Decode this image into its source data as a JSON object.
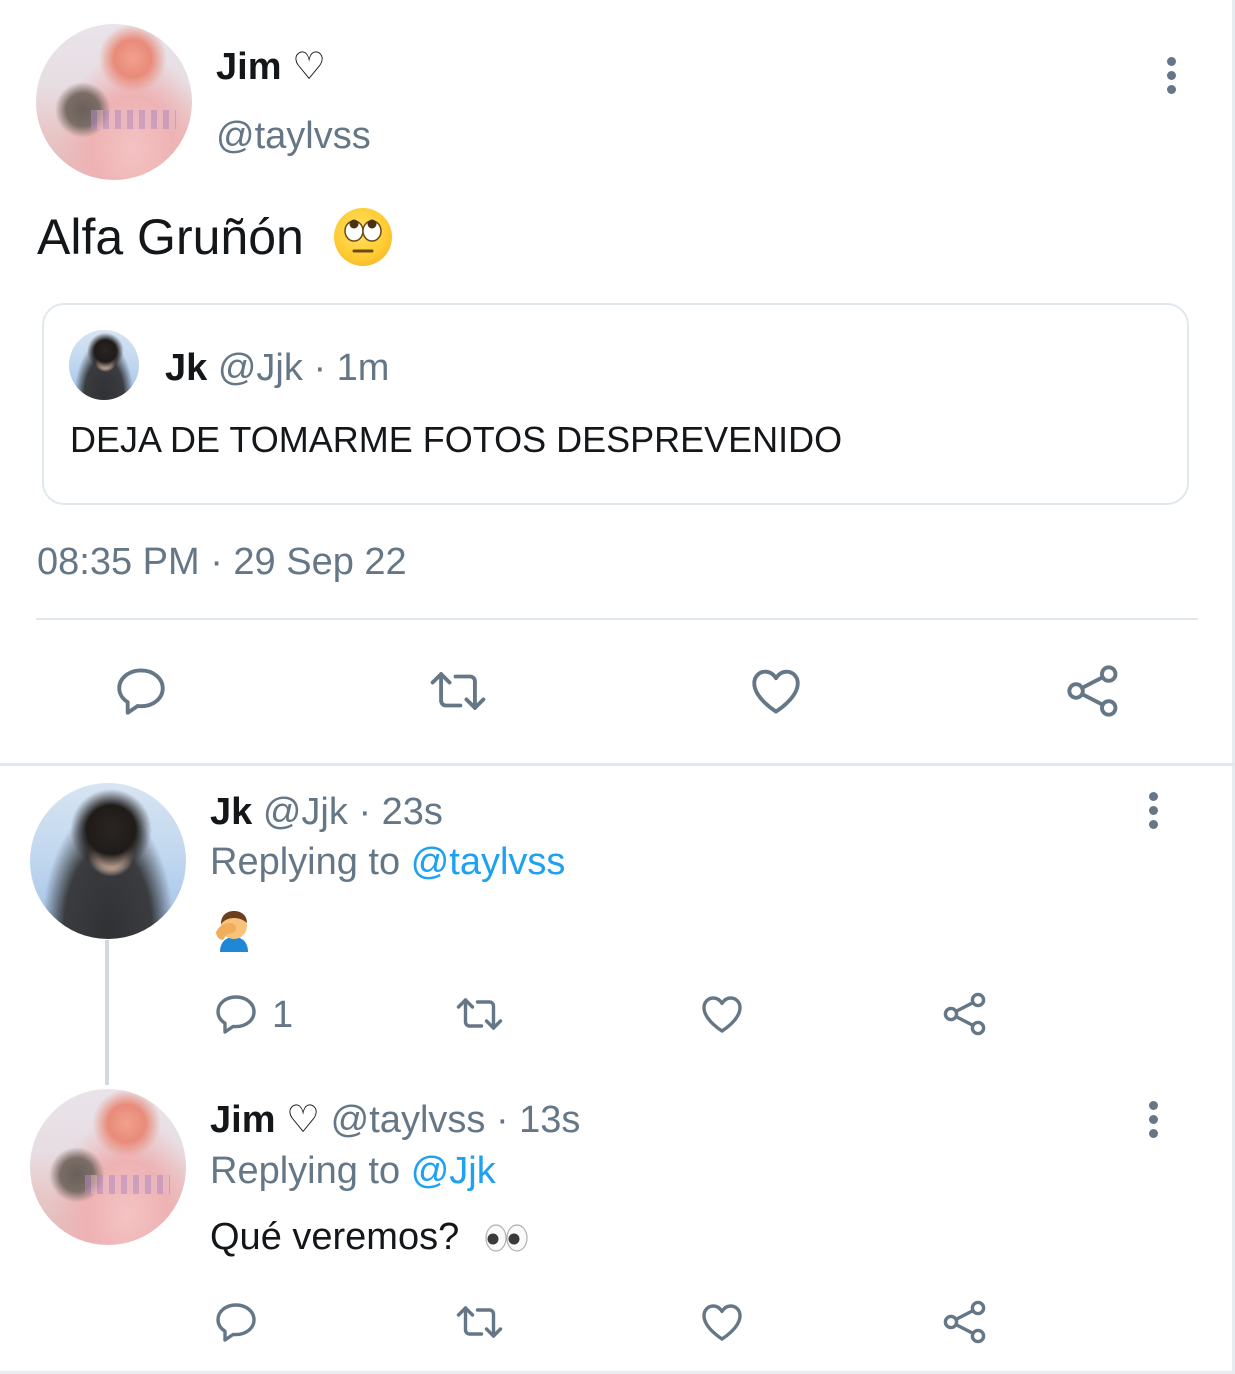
{
  "main_tweet": {
    "author_name": "Jim ♡",
    "author_handle": "@taylvss",
    "text": "Alfa Gruñón",
    "emoji_icon": "face-with-rolling-eyes-icon",
    "quoted": {
      "author_name": "Jk",
      "author_handle": "@Jjk",
      "time": "· 1m",
      "text": "DEJA DE TOMARME FOTOS DESPREVENIDO"
    },
    "timestamp": "08:35 PM · 29 Sep 22",
    "actions": [
      "reply-icon",
      "retweet-icon",
      "like-icon",
      "share-icon"
    ]
  },
  "replies": [
    {
      "author_name": "Jk",
      "author_handle": "@Jjk",
      "time": "· 23s",
      "replying_prefix": "Replying to",
      "replying_to": "@taylvss",
      "emoji_icon": "man-facepalming-icon",
      "reply_count": "1"
    },
    {
      "author_name": "Jim ♡",
      "author_handle": "@taylvss",
      "time": "· 13s",
      "replying_prefix": "Replying to",
      "replying_to": "@Jjk",
      "text": "Qué veremos?",
      "emoji_icon": "eyes-icon"
    }
  ],
  "colors": {
    "muted": "#657786",
    "link": "#1da1f2",
    "divider": "#e1e8ed",
    "text": "#14171a"
  }
}
